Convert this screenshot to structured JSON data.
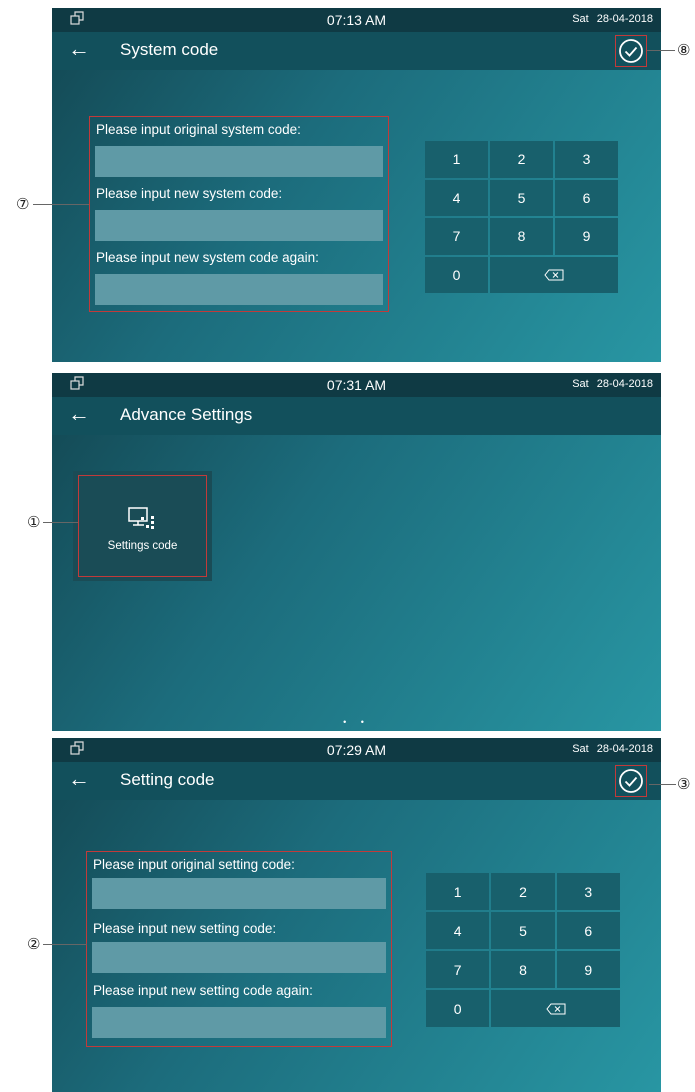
{
  "status_icon": "window-icon",
  "check_icon": "check-circle-icon",
  "back_icon": "arrow-left-icon",
  "screens": [
    {
      "time": "07:13 AM",
      "day": "Sat",
      "date": "28-04-2018",
      "back": "←",
      "title": "System code",
      "labels": [
        "Please input original system code:",
        "Please input new system code:",
        "Please input new system code again:"
      ],
      "keys": [
        "1",
        "2",
        "3",
        "4",
        "5",
        "6",
        "7",
        "8",
        "9",
        "0"
      ]
    },
    {
      "time": "07:31 AM",
      "day": "Sat",
      "date": "28-04-2018",
      "back": "←",
      "title": "Advance Settings",
      "tile_label": "Settings code",
      "dots": "• •"
    },
    {
      "time": "07:29 AM",
      "day": "Sat",
      "date": "28-04-2018",
      "back": "←",
      "title": "Setting code",
      "labels": [
        "Please input original setting code:",
        "Please input new setting code:",
        "Please input new setting code again:"
      ],
      "keys": [
        "1",
        "2",
        "3",
        "4",
        "5",
        "6",
        "7",
        "8",
        "9",
        "0"
      ]
    }
  ],
  "callouts": [
    "⑦",
    "⑧",
    "①",
    "②",
    "③"
  ],
  "colors": {
    "highlight": "#c23a3a",
    "titlebar": "#12505c",
    "statusbar": "#0f3a44",
    "field": "#5f9aa6",
    "key": "#18606c"
  }
}
